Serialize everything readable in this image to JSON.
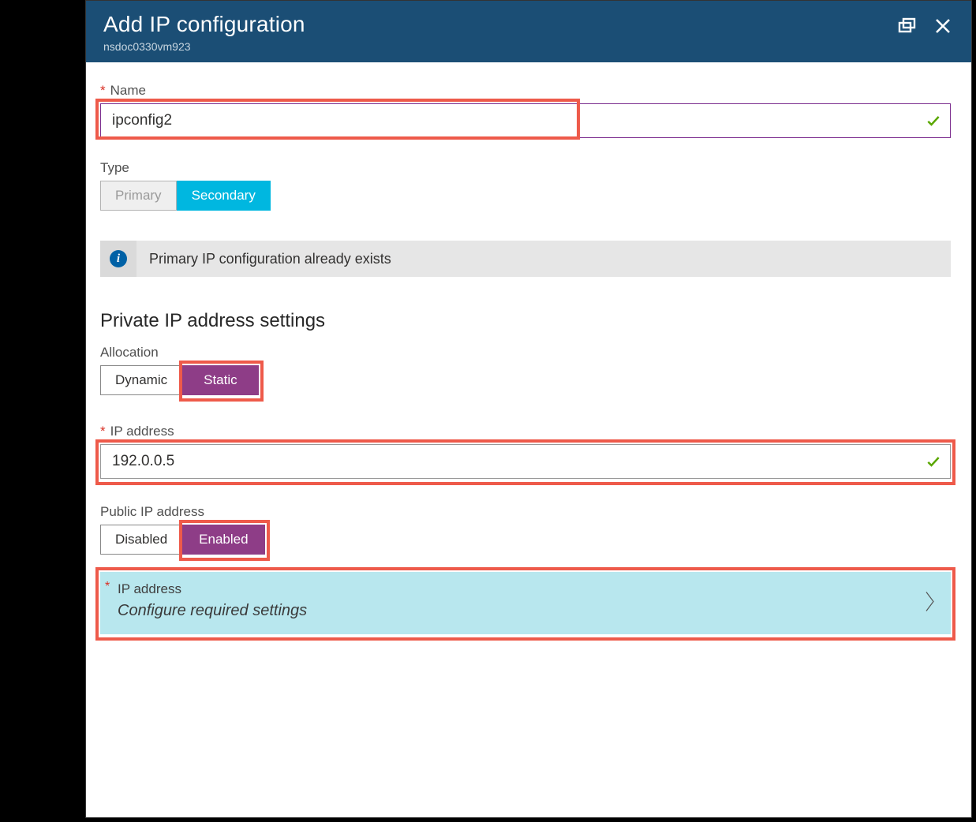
{
  "header": {
    "title": "Add IP configuration",
    "subtitle": "nsdoc0330vm923"
  },
  "name": {
    "label": "Name",
    "value": "ipconfig2"
  },
  "type": {
    "label": "Type",
    "options": {
      "primary": "Primary",
      "secondary": "Secondary"
    },
    "selected": "secondary"
  },
  "info_banner": "Primary IP configuration already exists",
  "private": {
    "section_title": "Private IP address settings",
    "allocation": {
      "label": "Allocation",
      "options": {
        "dynamic": "Dynamic",
        "static": "Static"
      },
      "selected": "static"
    },
    "ip": {
      "label": "IP address",
      "value": "192.0.0.5"
    }
  },
  "public": {
    "label": "Public IP address",
    "options": {
      "disabled": "Disabled",
      "enabled": "Enabled"
    },
    "selected": "enabled",
    "picker": {
      "label": "IP address",
      "placeholder": "Configure required settings"
    }
  }
}
